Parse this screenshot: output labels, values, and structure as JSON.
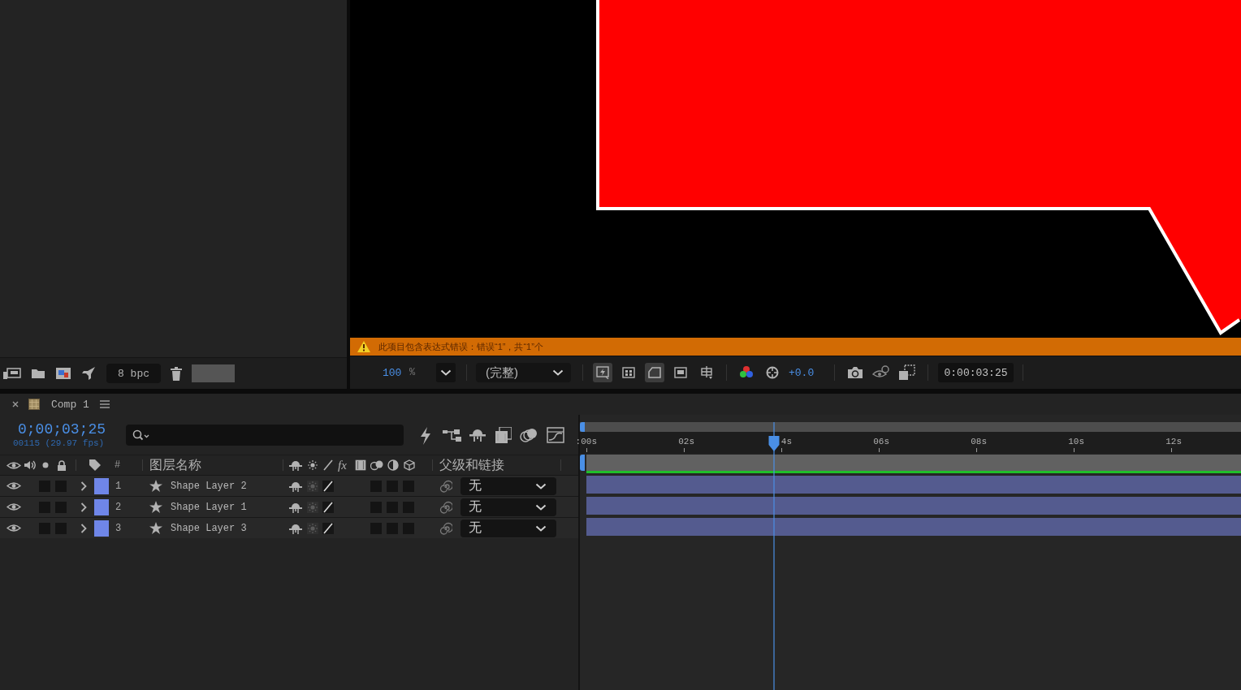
{
  "project_panel": {
    "bit_depth": "8 bpc"
  },
  "viewer": {
    "warning": "此项目包含表达式错误：错误“1”，共“1”个",
    "zoom": "100",
    "zoom_unit": "%",
    "resolution": "(完整)",
    "view_toggles": [
      {
        "kind": "preview",
        "on": true
      },
      {
        "kind": "transparency",
        "on": false
      },
      {
        "kind": "mask",
        "on": true
      },
      {
        "kind": "region",
        "on": false
      },
      {
        "kind": "guides",
        "on": false
      }
    ],
    "exposure": "+0.0",
    "timecode": "0:00:03:25"
  },
  "timeline": {
    "tab": "Comp 1",
    "timecode": "0;00;03;25",
    "frame_info": "00115 (29.97 fps)",
    "columns": {
      "number": "#",
      "layer_name": "图层名称",
      "effects": "fx",
      "parent": "父级和链接"
    },
    "layers": [
      {
        "number": "1",
        "name": "Shape Layer 2",
        "color": "#6f86e8",
        "visible": true,
        "solo": false,
        "locked": false,
        "expanded": false,
        "motion_blur": false,
        "adjustment": false,
        "three_d": false,
        "parent": "无"
      },
      {
        "number": "2",
        "name": "Shape Layer 1",
        "color": "#6f86e8",
        "visible": true,
        "solo": false,
        "locked": false,
        "expanded": false,
        "motion_blur": false,
        "adjustment": false,
        "three_d": false,
        "parent": "无"
      },
      {
        "number": "3",
        "name": "Shape Layer 3",
        "color": "#6f86e8",
        "visible": true,
        "solo": false,
        "locked": false,
        "expanded": false,
        "motion_blur": false,
        "adjustment": false,
        "three_d": false,
        "parent": "无"
      }
    ],
    "ruler": [
      ":00s",
      "02s",
      "4s",
      "06s",
      "08s",
      "10s",
      "12s"
    ],
    "playhead": {
      "level": 0.286
    }
  }
}
